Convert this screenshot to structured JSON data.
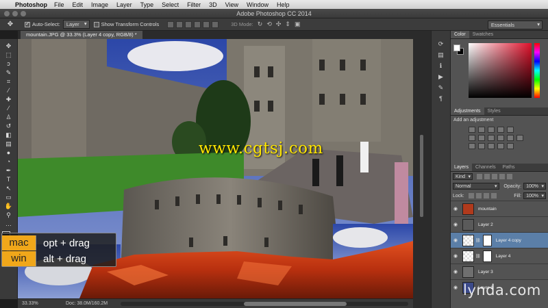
{
  "menubar": {
    "app": "Photoshop",
    "items": [
      "File",
      "Edit",
      "Image",
      "Layer",
      "Type",
      "Select",
      "Filter",
      "3D",
      "View",
      "Window",
      "Help"
    ]
  },
  "window": {
    "title": "Adobe Photoshop CC 2014"
  },
  "options": {
    "auto_select_label": "Auto-Select:",
    "auto_select_value": "Layer",
    "transform_label": "Show Transform Controls",
    "mode_3d_label": "3D Mode:",
    "workspace": "Essentials"
  },
  "document": {
    "tab": "mountain.JPG @ 33.3% (Layer 4 copy, RGB/8) *",
    "watermark": "www.cgtsj.com"
  },
  "shortcut": {
    "rows": [
      {
        "os": "mac",
        "keys": "opt + drag"
      },
      {
        "os": "win",
        "keys": "alt + drag"
      }
    ]
  },
  "status": {
    "zoom": "33.33%",
    "doc": "Doc: 38.0M/160.2M"
  },
  "panels": {
    "color_tabs": [
      "Color",
      "Swatches"
    ],
    "adjust_tabs": [
      "Adjustments",
      "Styles"
    ],
    "add_adjustment": "Add an adjustment",
    "layers_tabs": [
      "Layers",
      "Channels",
      "Paths"
    ],
    "kind": "Kind",
    "blend": "Normal",
    "opacity_label": "Opacity:",
    "opacity": "100%",
    "lock_label": "Lock:",
    "fill_label": "Fill:",
    "fill": "100%",
    "layers": [
      {
        "name": "mountain",
        "selected": false,
        "mask": false,
        "thumb": "#b03a1c"
      },
      {
        "name": "Layer 2",
        "selected": false,
        "mask": false,
        "thumb": "#5a5a5a"
      },
      {
        "name": "Layer 4 copy",
        "selected": true,
        "mask": true,
        "thumb": "checker"
      },
      {
        "name": "Layer 4",
        "selected": false,
        "mask": true,
        "thumb": "checker"
      },
      {
        "name": "Layer 3",
        "selected": false,
        "mask": false,
        "thumb": "#6f6f6f"
      },
      {
        "name": "Layer 1",
        "selected": false,
        "mask": false,
        "thumb": "#3c4a8a"
      }
    ]
  },
  "brand": {
    "name": "lynda",
    "suffix": ".com"
  }
}
